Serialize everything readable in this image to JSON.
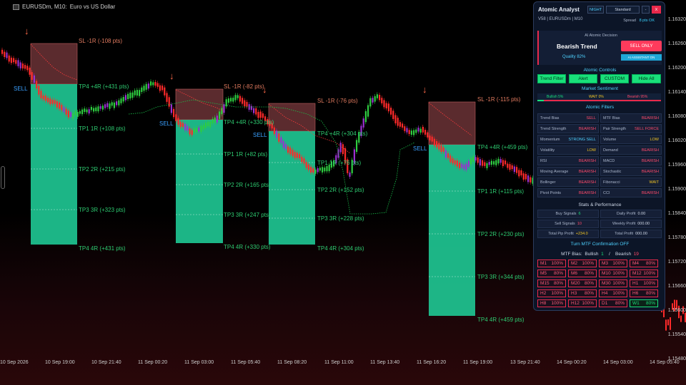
{
  "chart": {
    "symbol": "EURUSDm, M10:",
    "description": "Euro vs US Dollar",
    "prices": [
      "1.16320",
      "1.16260",
      "1.16200",
      "1.16140",
      "1.16080",
      "1.16020",
      "1.15960",
      "1.15900",
      "1.15840",
      "1.15780",
      "1.15720",
      "1.15660",
      "1.15600",
      "1.15540",
      "1.15480"
    ],
    "times": [
      "10 Sep 2026",
      "10 Sep 19:00",
      "10 Sep 21:40",
      "11 Sep 00:20",
      "11 Sep 03:00",
      "11 Sep 05:40",
      "11 Sep 08:20",
      "11 Sep 11:00",
      "11 Sep 13:40",
      "11 Sep 16:20",
      "11 Sep 19:00",
      "13 Sep 21:40",
      "14 Sep 00:20",
      "14 Sep 03:00",
      "14 Sep 05:40"
    ],
    "trades": [
      {
        "sl": "SL -1R (-108 pts)",
        "tp4a": "TP4  +4R (+431 pts)",
        "tp1": "TP1  1R (+108 pts)",
        "tp2": "TP2  2R (+215 pts)",
        "tp3": "TP3  3R (+323 pts)",
        "tp4": "TP4  4R (+431 pts)",
        "signal": "SELL"
      },
      {
        "sl": "SL -1R (-82 pts)",
        "tp4a": "TP4  +4R (+330 pts)",
        "tp1": "TP1  1R (+82 pts)",
        "tp2": "TP2  2R (+165 pts)",
        "tp3": "TP3  3R (+247 pts)",
        "tp4": "TP4  4R (+330 pts)",
        "signal": "SELL"
      },
      {
        "sl": "SL -1R (-76 pts)",
        "tp4a": "TP4  +4R (+304 pts)",
        "tp1": "TP1  1R (+76 pts)",
        "tp2": "TP2  2R (+152 pts)",
        "tp3": "TP3  3R (+228 pts)",
        "tp4": "TP4  4R (+304 pts)",
        "signal": "SELL"
      },
      {
        "sl": "SL -1R (-115 pts)",
        "tp4a": "TP4  +4R (+459 pts)",
        "tp1": "TP1  1R (+115 pts)",
        "tp2": "TP2  2R (+230 pts)",
        "tp3": "TP3  3R (+344 pts)",
        "tp4": "TP4  4R (+459 pts)",
        "signal": "SELL"
      }
    ],
    "colors": {
      "bull": "#2ecc40",
      "bear": "#ff2a2a",
      "neutral": "#9b30d0",
      "sl_zone": "#7a3a3e",
      "tp_zone": "#1fc995"
    }
  },
  "panel": {
    "title": "Atomic Analyst",
    "night_btn": "NIGHT",
    "standard_btn": "Standard",
    "min_btn": "-",
    "close_btn": "X",
    "subtitle": "V58 | EURUSDm | M10",
    "spread_label": "Spread",
    "spread_value": "8 pts OK",
    "decision_header": "AI Atomic Decision",
    "trend": "Bearish Trend",
    "quality": "Quality 82%",
    "sell_only": "SELL ONLY",
    "ai_assistant": "AI ASSISTANT ON",
    "controls_title": "Atomic Controls",
    "controls": [
      "Trend Filter",
      "Alert",
      "CUSTOM",
      "Hide All"
    ],
    "sentiment_title": "Market Sentiment",
    "sent_bull": "Bullish 5%",
    "sent_wait": "WAIT 0%",
    "sent_bear": "Bearish 95%",
    "filters_title": "Atomic Filters",
    "filters": [
      {
        "name": "Trend Bias",
        "value": "SELL",
        "color": "#ff4a6a"
      },
      {
        "name": "MTF Bias",
        "value": "BEARISH",
        "color": "#ff4a6a"
      },
      {
        "name": "Trend Strength",
        "value": "BEARISH",
        "color": "#ff4a6a"
      },
      {
        "name": "Pair Strength",
        "value": "SELL FORCE",
        "color": "#ff4a6a"
      },
      {
        "name": "Momentum",
        "value": "STRONG SELL",
        "color": "#4ed1ff"
      },
      {
        "name": "Volume",
        "value": "LOW",
        "color": "#f3c623"
      },
      {
        "name": "Volatility",
        "value": "LOW",
        "color": "#f3c623"
      },
      {
        "name": "Demand",
        "value": "BEARISH",
        "color": "#ff4a6a"
      },
      {
        "name": "RSI",
        "value": "BEARISH",
        "color": "#ff4a6a"
      },
      {
        "name": "MACD",
        "value": "BEARISH",
        "color": "#ff4a6a"
      },
      {
        "name": "Moving Average",
        "value": "BEARISH",
        "color": "#ff4a6a"
      },
      {
        "name": "Stochastic",
        "value": "BEARISH",
        "color": "#ff4a6a"
      },
      {
        "name": "Bollinger",
        "value": "BEARISH",
        "color": "#ff4a6a"
      },
      {
        "name": "Fibonacci",
        "value": "WAIT",
        "color": "#f3c623"
      },
      {
        "name": "Pivot Points",
        "value": "BEARISH",
        "color": "#ff4a6a"
      },
      {
        "name": "CCI",
        "value": "BEARISH",
        "color": "#ff4a6a"
      }
    ],
    "stats_title": "Stats & Performance",
    "stats": [
      {
        "name": "Buy Signals",
        "value": "6",
        "color": "#19e07a"
      },
      {
        "name": "Daily Profit",
        "value": "0.00",
        "color": "#cfd8e8"
      },
      {
        "name": "Sell Signals",
        "value": "10",
        "color": "#ff4a6a"
      },
      {
        "name": "Weekly Profit",
        "value": "000.00",
        "color": "#cfd8e8"
      },
      {
        "name": "Total Pip Profit",
        "value": "+234.0",
        "color": "#f3c623"
      },
      {
        "name": "Total Profit",
        "value": "000.00",
        "color": "#cfd8e8"
      }
    ],
    "mtf_toggle": "Turn MTF Confirmation OFF",
    "mtf_bias_label": "MTF Bias:",
    "mtf_bullish_label": "Bullish",
    "mtf_bullish": "1",
    "mtf_sep": "/",
    "mtf_bearish_label": "Bearish",
    "mtf_bearish": "19",
    "mtf": [
      {
        "tf": "M1",
        "pct": "100%",
        "bull": false
      },
      {
        "tf": "M2",
        "pct": "100%",
        "bull": false
      },
      {
        "tf": "M3",
        "pct": "100%",
        "bull": false
      },
      {
        "tf": "M4",
        "pct": "80%",
        "bull": false
      },
      {
        "tf": "M5",
        "pct": "80%",
        "bull": false
      },
      {
        "tf": "M6",
        "pct": "80%",
        "bull": false
      },
      {
        "tf": "M10",
        "pct": "100%",
        "bull": false
      },
      {
        "tf": "M12",
        "pct": "100%",
        "bull": false
      },
      {
        "tf": "M15",
        "pct": "80%",
        "bull": false
      },
      {
        "tf": "M20",
        "pct": "80%",
        "bull": false
      },
      {
        "tf": "M30",
        "pct": "100%",
        "bull": false
      },
      {
        "tf": "H1",
        "pct": "100%",
        "bull": false
      },
      {
        "tf": "H2",
        "pct": "100%",
        "bull": false
      },
      {
        "tf": "H3",
        "pct": "80%",
        "bull": false
      },
      {
        "tf": "H4",
        "pct": "100%",
        "bull": false
      },
      {
        "tf": "H6",
        "pct": "80%",
        "bull": false
      },
      {
        "tf": "H8",
        "pct": "100%",
        "bull": false
      },
      {
        "tf": "H12",
        "pct": "100%",
        "bull": false
      },
      {
        "tf": "D1",
        "pct": "80%",
        "bull": false
      },
      {
        "tf": "W1",
        "pct": "80%",
        "bull": true
      }
    ]
  }
}
